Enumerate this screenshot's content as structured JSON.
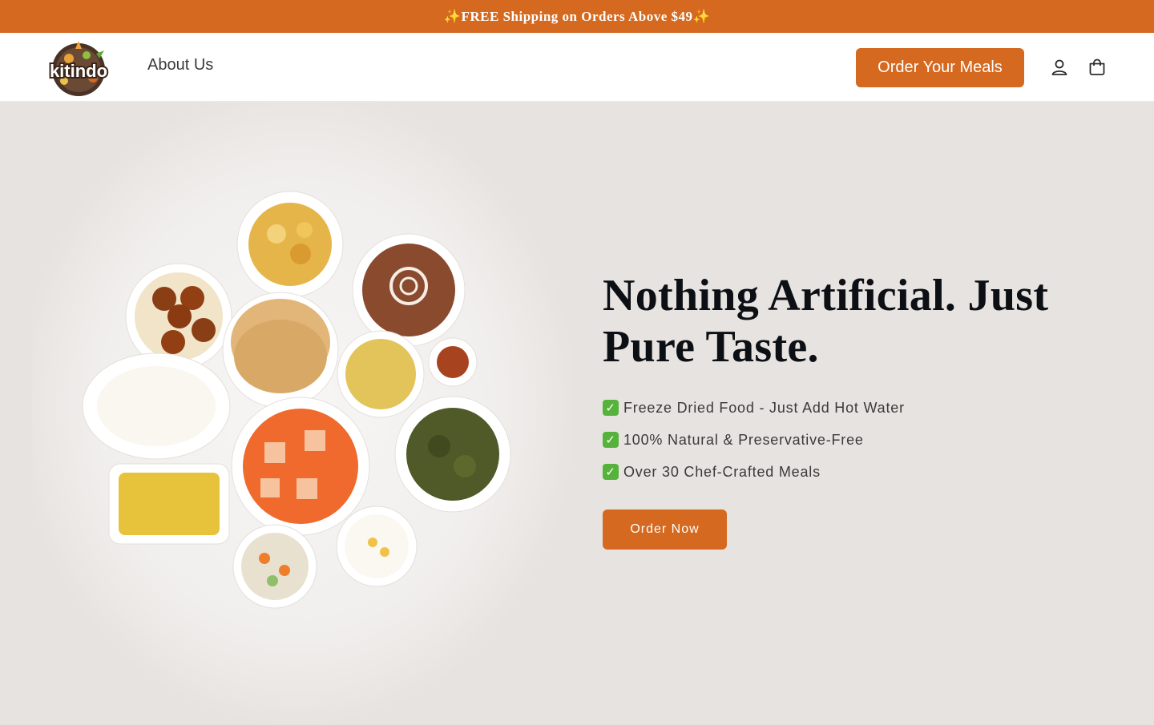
{
  "announcement": {
    "text": "✨FREE Shipping on Orders Above $49✨"
  },
  "header": {
    "logo_text": "kitindo",
    "nav": {
      "about_label": "About Us"
    },
    "order_meals_label": "Order Your Meals",
    "account_icon": "user-icon",
    "cart_icon": "shopping-bag-icon"
  },
  "hero": {
    "title": "Nothing Artificial. Just Pure Taste.",
    "features": [
      {
        "check_icon": "check-icon",
        "text": "Freeze Dried Food - Just Add Hot Water"
      },
      {
        "check_icon": "check-icon",
        "text": "100% Natural & Preservative-Free"
      },
      {
        "check_icon": "check-icon",
        "text": "Over 30 Chef-Crafted Meals"
      }
    ],
    "cta_label": "Order Now",
    "image_alt": "Indian thali dishes"
  },
  "colors": {
    "brand_orange": "#d4691f",
    "hero_bg": "#e7e3e0",
    "check_green": "#55b33c",
    "title_text": "#0c0f14"
  }
}
